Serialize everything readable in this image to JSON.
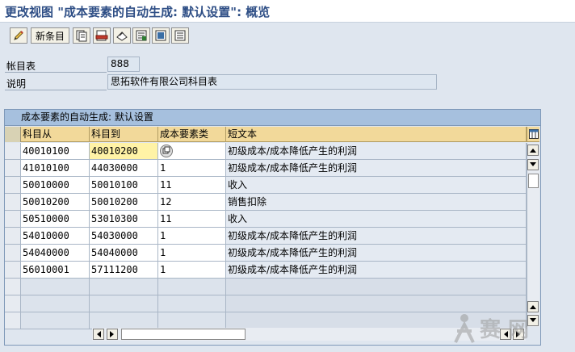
{
  "title": "更改视图 \"成本要素的自动生成: 默认设置\": 概览",
  "toolbar": {
    "new_entries_label": "新条目",
    "icons": [
      "edit-pencil-icon",
      "copy-icon",
      "delete-icon",
      "undo-icon",
      "select-all-icon",
      "select-block-icon",
      "deselect-all-icon"
    ]
  },
  "fields": {
    "chart_of_accounts_label": "帐目表",
    "chart_of_accounts_value": "888",
    "description_label": "说明",
    "description_value": "思拓软件有限公司科目表"
  },
  "table": {
    "title": "成本要素的自动生成: 默认设置",
    "columns": [
      "科目从",
      "科目到",
      "成本要素类",
      "短文本"
    ],
    "rows": [
      {
        "from": "40010100",
        "to": "40010200",
        "category": "",
        "text": "初级成本/成本降低产生的利润"
      },
      {
        "from": "41010100",
        "to": "44030000",
        "category": "1",
        "text": "初级成本/成本降低产生的利润"
      },
      {
        "from": "50010000",
        "to": "50010100",
        "category": "11",
        "text": "收入"
      },
      {
        "from": "50010200",
        "to": "50010200",
        "category": "12",
        "text": "销售扣除"
      },
      {
        "from": "50510000",
        "to": "53010300",
        "category": "11",
        "text": "收入"
      },
      {
        "from": "54010000",
        "to": "54030000",
        "category": "1",
        "text": "初级成本/成本降低产生的利润"
      },
      {
        "from": "54040000",
        "to": "54040000",
        "category": "1",
        "text": "初级成本/成本降低产生的利润"
      },
      {
        "from": "56010001",
        "to": "57111200",
        "category": "1",
        "text": "初级成本/成本降低产生的利润"
      }
    ]
  },
  "watermark": "赛 网"
}
